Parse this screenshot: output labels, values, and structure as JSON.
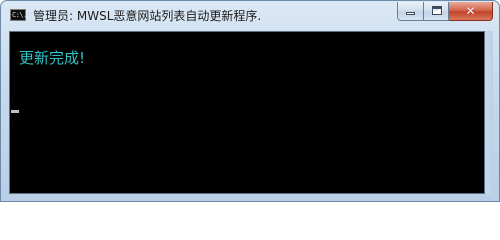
{
  "window": {
    "title": "管理员:  MWSL恶意网站列表自动更新程序.",
    "icon": "console-icon",
    "icon_text": "C:\\.",
    "buttons": {
      "minimize": "minimize-icon",
      "maximize": "maximize-icon",
      "close": "close-icon",
      "close_glyph": "✕"
    }
  },
  "console": {
    "lines": [
      "更新完成!"
    ],
    "text_color": "#30c2c6",
    "background": "#000000"
  }
}
